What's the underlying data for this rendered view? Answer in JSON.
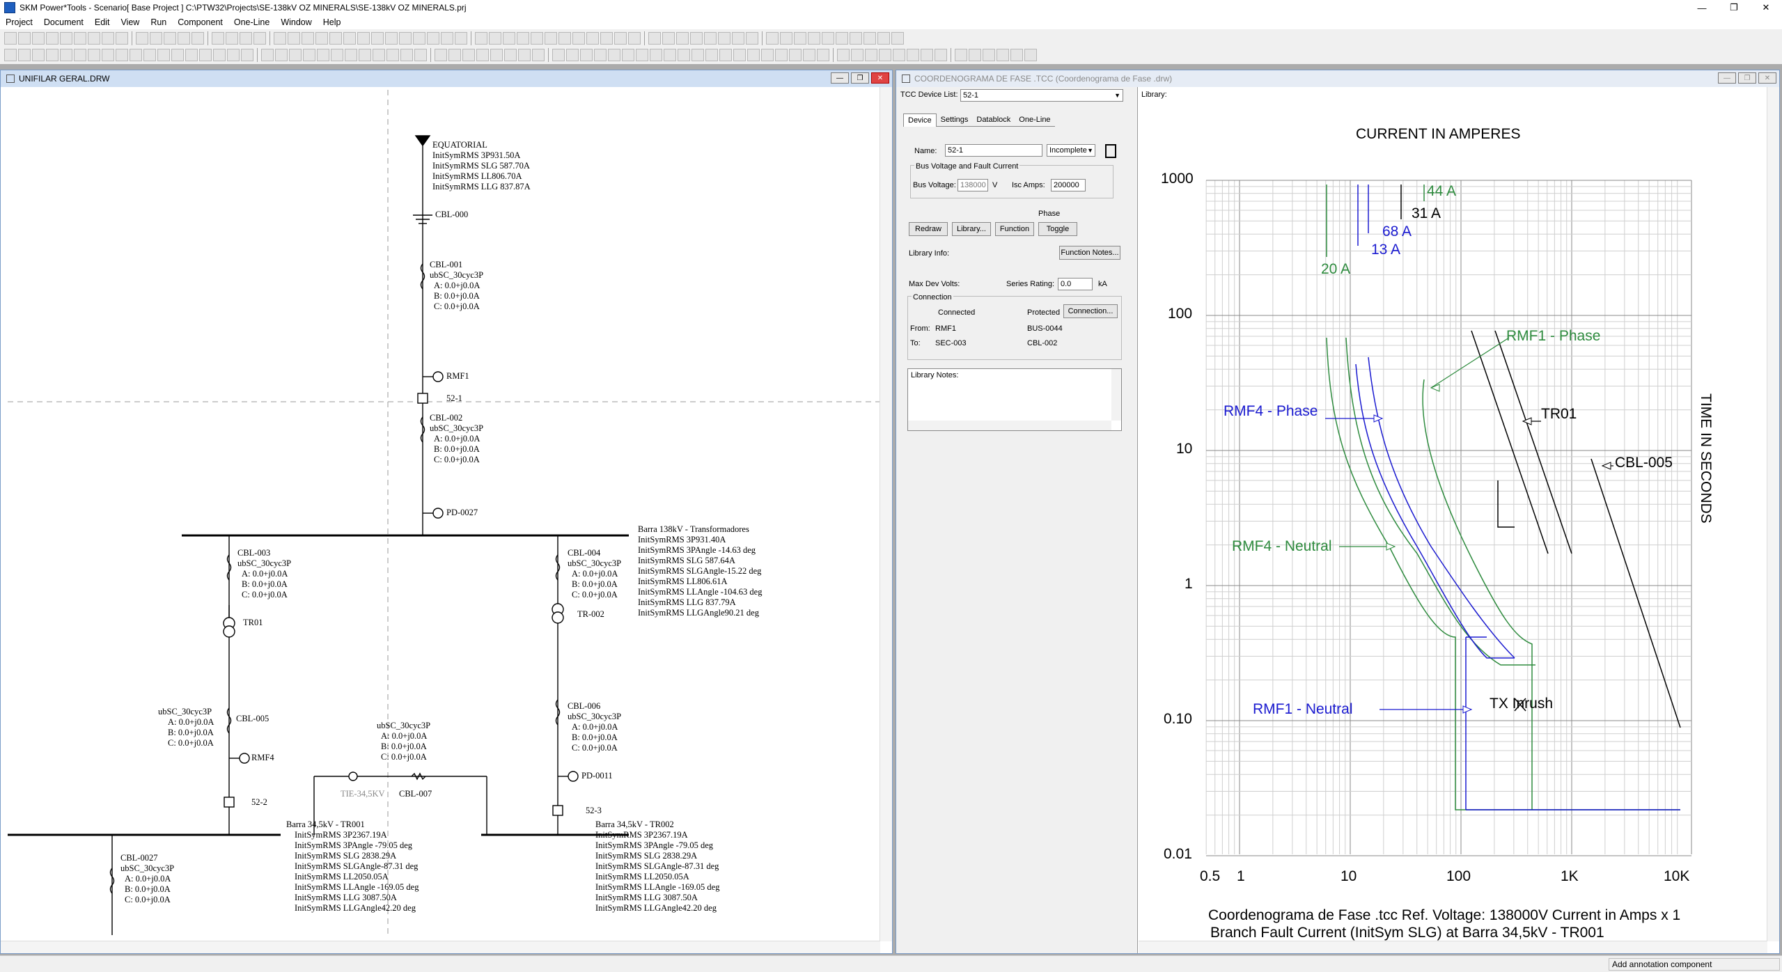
{
  "window": {
    "title": "SKM Power*Tools - Scenario[ Base Project ] C:\\PTW32\\Projects\\SE-138kV OZ MINERALS\\SE-138kV OZ MINERALS.prj"
  },
  "menu": [
    "Project",
    "Document",
    "Edit",
    "View",
    "Run",
    "Component",
    "One-Line",
    "Window",
    "Help"
  ],
  "oneline": {
    "title": "UNIFILAR GERAL.DRW",
    "labels": {
      "equatorial": [
        "EQUATORIAL",
        "InitSymRMS 3P931.50A",
        "InitSymRMS SLG 587.70A",
        "InitSymRMS LL806.70A",
        "InitSymRMS LLG 837.87A"
      ],
      "cbl000": "CBL-000",
      "cbl001": [
        "CBL-001",
        "ubSC_30cyc3P",
        "A: 0.0+j0.0A",
        "B: 0.0+j0.0A",
        "C: 0.0+j0.0A"
      ],
      "rmf1": "RMF1",
      "b521": "52-1",
      "cbl002": [
        "CBL-002",
        "ubSC_30cyc3P",
        "A: 0.0+j0.0A",
        "B: 0.0+j0.0A",
        "C: 0.0+j0.0A"
      ],
      "pd0027": "PD-0027",
      "barra138": [
        "Barra 138kV - Transformadores",
        "InitSymRMS 3P931.40A",
        "InitSymRMS 3PAngle -14.63 deg",
        "InitSymRMS SLG 587.64A",
        "InitSymRMS SLGAngle-15.22 deg",
        "InitSymRMS LL806.61A",
        "InitSymRMS LLAngle -104.63 deg",
        "InitSymRMS LLG 837.79A",
        "InitSymRMS LLGAngle90.21 deg"
      ],
      "cbl003": [
        "CBL-003",
        "ubSC_30cyc3P",
        "A: 0.0+j0.0A",
        "B: 0.0+j0.0A",
        "C: 0.0+j0.0A"
      ],
      "cbl004": [
        "CBL-004",
        "ubSC_30cyc3P",
        "A: 0.0+j0.0A",
        "B: 0.0+j0.0A",
        "C: 0.0+j0.0A"
      ],
      "tr01": "TR01",
      "tr002": "TR-002",
      "cbl005": [
        "ubSC_30cyc3P",
        "A: 0.0+j0.0A",
        "B: 0.0+j0.0A",
        "C: 0.0+j0.0A"
      ],
      "cbl005name": "CBL-005",
      "cbl006": [
        "CBL-006",
        "ubSC_30cyc3P",
        "A: 0.0+j0.0A",
        "B: 0.0+j0.0A",
        "C: 0.0+j0.0A"
      ],
      "tie": [
        "ubSC_30cyc3P",
        "A: 0.0+j0.0A",
        "B: 0.0+j0.0A",
        "C: 0.0+j0.0A"
      ],
      "rmf4": "RMF4",
      "pd0011": "PD-0011",
      "tie34": "TIE-34,5KV",
      "cbl007": "CBL-007",
      "b522": "52-2",
      "b523": "52-3",
      "barra345_1": [
        "Barra 34,5kV - TR001",
        "InitSymRMS 3P2367.19A",
        "InitSymRMS 3PAngle -79.05 deg",
        "InitSymRMS SLG 2838.29A",
        "InitSymRMS SLGAngle-87.31 deg",
        "InitSymRMS LL2050.05A",
        "InitSymRMS LLAngle -169.05 deg",
        "InitSymRMS LLG 3087.50A",
        "InitSymRMS LLGAngle42.20 deg"
      ],
      "barra345_2": [
        "Barra 34,5kV - TR002",
        "InitSymRMS 3P2367.19A",
        "InitSymRMS 3PAngle -79.05 deg",
        "InitSymRMS SLG 2838.29A",
        "InitSymRMS SLGAngle-87.31 deg",
        "InitSymRMS LL2050.05A",
        "InitSymRMS LLAngle -169.05 deg",
        "InitSymRMS LLG 3087.50A",
        "InitSymRMS LLGAngle42.20 deg"
      ],
      "cbl0027": [
        "CBL-0027",
        "ubSC_30cyc3P",
        "A: 0.0+j0.0A",
        "B: 0.0+j0.0A",
        "C: 0.0+j0.0A"
      ]
    }
  },
  "tcc": {
    "title": "COORDENOGRAMA DE FASE .TCC (Coordenograma de Fase .drw)",
    "device_list_label": "TCC Device List:",
    "device_list_value": "52-1",
    "library_label": "Library:",
    "tabs": [
      "Device",
      "Settings",
      "Datablock",
      "One-Line"
    ],
    "name_label": "Name:",
    "name_value": "52-1",
    "status_value": "Incomplete",
    "bus_group": "Bus Voltage and Fault Current",
    "bus_voltage_label": "Bus Voltage:",
    "bus_voltage_value": "138000",
    "bus_voltage_unit": "V",
    "isc_label": "Isc Amps:",
    "isc_value": "200000",
    "phase_label": "Phase",
    "buttons": [
      "Redraw",
      "Library...",
      "Function",
      "Toggle"
    ],
    "library_info_label": "Library Info:",
    "function_notes": "Function Notes...",
    "max_dev_volts": "Max Dev Volts:",
    "series_rating_label": "Series Rating:",
    "series_rating_value": "0.0",
    "series_rating_unit": "kA",
    "connection_group": "Connection",
    "connected_label": "Connected",
    "protected_label": "Protected",
    "connection_button": "Connection...",
    "from_label": "From:",
    "from_value": "RMF1",
    "from_protected": "BUS-0044",
    "to_label": "To:",
    "to_value": "SEC-003",
    "to_protected": "CBL-002",
    "library_notes_label": "Library Notes:",
    "plot": {
      "top_title": "CURRENT IN AMPERES",
      "y_title": "TIME IN SECONDS",
      "y_ticks": [
        "1000",
        "100",
        "10",
        "1",
        "0.10",
        "0.01"
      ],
      "x_ticks": [
        "0.5",
        "1",
        "10",
        "100",
        "1K",
        "10K"
      ],
      "footer1": "Coordenograma de Fase .tcc    Ref. Voltage: 138000V    Current in Amps x 1",
      "footer2": "Branch Fault Current (InitSym SLG) at Barra 34,5kV - TR001",
      "labels": {
        "a44": "44 A",
        "a31": "31 A",
        "a68": "68 A",
        "a13": "13 A",
        "a20": "20 A",
        "rmf1_phase": "RMF1 - Phase",
        "rmf4_phase": "RMF4 - Phase",
        "tr01": "TR01",
        "cbl005": "CBL-005",
        "rmf4_neutral": "RMF4 - Neutral",
        "rmf1_neutral": "RMF1 - Neutral",
        "tx_inrush": "TX Inrush"
      },
      "colors": {
        "green": "#2e8b3e",
        "blue": "#1a1ad0",
        "black": "#000000"
      }
    }
  },
  "status": {
    "hint": "Add annotation component"
  }
}
